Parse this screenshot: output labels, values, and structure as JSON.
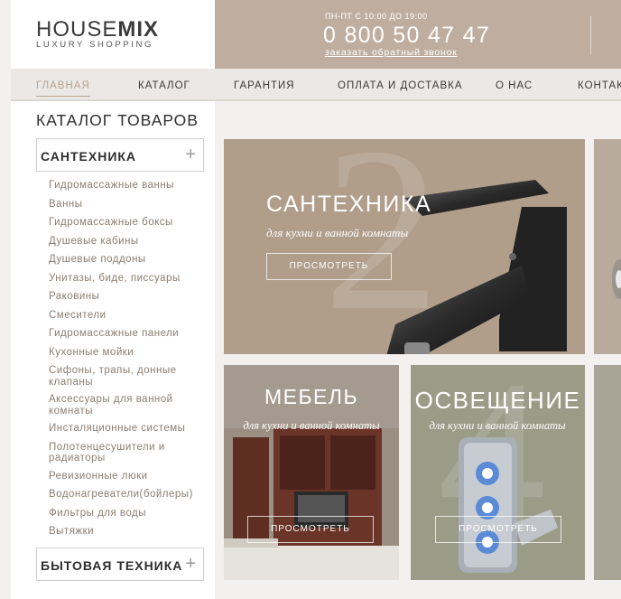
{
  "header": {
    "logo_light": "HOUSE",
    "logo_bold": "MIX",
    "logo_tagline": "LUXURY SHOPPING",
    "hours": "ПН-ПТ С 10:00 ДО 19:00",
    "phone": "0 800 50 47 47",
    "callback": "заказать обратный звонок"
  },
  "nav": [
    {
      "label": "ГЛАВНАЯ",
      "active": true
    },
    {
      "label": "КАТАЛОГ"
    },
    {
      "label": "ГАРАНТИЯ"
    },
    {
      "label": "ОПЛАТА И ДОСТАВКА"
    },
    {
      "label": "О НАС"
    },
    {
      "label": "КОНТАКТ"
    }
  ],
  "sidebar": {
    "title": "КАТАЛОГ ТОВАРОВ",
    "category_1": "САНТЕХНИКА",
    "category_2": "БЫТОВАЯ ТЕХНИКА",
    "plus_glyph": "+",
    "items": [
      "Гидромассажные ванны",
      "Ванны",
      "Гидромассажные боксы",
      "Душевые кабины",
      "Душевые поддоны",
      "Унитазы, биде, писсуары",
      "Раковины",
      "Смесители",
      "Гидромассажные панели",
      "Кухонные мойки",
      "Сифоны, трапы, донные клапаны",
      "Аксессуары для ванной комнаты",
      "Инсталяционные системы",
      "Полотенцесушители и радиаторы",
      "Ревизионные люки",
      "Водонагреватели(бойлеры)",
      "Фильтры для воды",
      "Вытяжки"
    ]
  },
  "banners": {
    "plumbing": {
      "title": "САНТЕХНИКА",
      "subtitle": "для кухни и ванной комнаты",
      "button": "ПРОСМОТРЕТЬ",
      "color": "#b09e8b"
    },
    "furniture": {
      "title": "МЕБЕЛЬ",
      "subtitle": "для кухни и ванной комнаты",
      "button": "ПРОСМОТРЕТЬ",
      "color": "#a59a8f"
    },
    "lighting": {
      "title": "ОСВЕЩЕНИЕ",
      "subtitle": "для кухни и ванной комнаты",
      "button": "ПРОСМОТРЕТЬ",
      "color": "#9a9c88"
    }
  },
  "colors": {
    "accent": "#b9a58d",
    "header_bar": "#bfae9f",
    "sub_link": "#8a7d72"
  }
}
